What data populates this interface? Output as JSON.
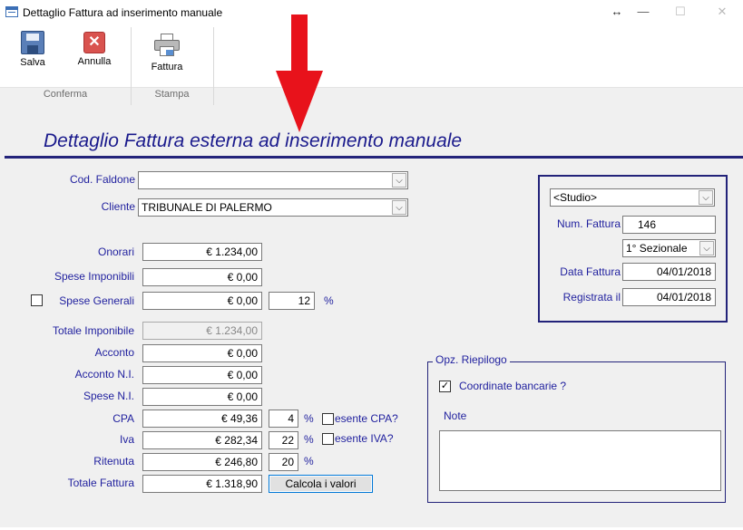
{
  "window": {
    "title": "Dettaglio Fattura ad inserimento manuale",
    "resize_glyph": "↔",
    "minimize_glyph": "—",
    "maximize_glyph": "☐",
    "close_glyph": "✕"
  },
  "ribbon": {
    "groups": [
      {
        "label": "Conferma"
      },
      {
        "label": "Stampa"
      }
    ],
    "buttons": {
      "save": {
        "label": "Salva",
        "icon": "floppy-disk-icon"
      },
      "cancel": {
        "label": "Annulla",
        "icon": "cancel-x-icon",
        "glyph": "✕"
      },
      "invoice": {
        "label": "Fattura",
        "icon": "printer-icon"
      }
    }
  },
  "heading": "Dettaglio Fattura esterna ad inserimento manuale",
  "form": {
    "cod_faldone": {
      "label": "Cod. Faldone",
      "value": ""
    },
    "cliente": {
      "label": "Cliente",
      "value": "TRIBUNALE DI PALERMO"
    },
    "onorari": {
      "label": "Onorari",
      "value": "€ 1.234,00"
    },
    "spese_imponibili": {
      "label": "Spese Imponibili",
      "value": "€ 0,00"
    },
    "spese_generali": {
      "label": "Spese Generali",
      "value": "€ 0,00",
      "percent": "12",
      "checked": false
    },
    "totale_imponibile": {
      "label": "Totale Imponibile",
      "value": "€ 1.234,00"
    },
    "acconto": {
      "label": "Acconto",
      "value": "€ 0,00"
    },
    "acconto_ni": {
      "label": "Acconto N.I.",
      "value": "€ 0,00"
    },
    "spese_ni": {
      "label": "Spese N.I.",
      "value": "€ 0,00"
    },
    "cpa": {
      "label": "CPA",
      "value": "€ 49,36",
      "percent": "4",
      "exempt_label": "esente CPA?",
      "exempt_checked": false
    },
    "iva": {
      "label": "Iva",
      "value": "€ 282,34",
      "percent": "22",
      "exempt_label": "esente IVA?",
      "exempt_checked": false
    },
    "ritenuta": {
      "label": "Ritenuta",
      "value": "€ 246,80",
      "percent": "20"
    },
    "totale_fattura": {
      "label": "Totale Fattura",
      "value": "€ 1.318,90"
    },
    "percent_sign": "%",
    "calc_button": "Calcola i valori"
  },
  "studio_panel": {
    "studio": "<Studio>",
    "num_fattura_label": "Num. Fattura",
    "num_fattura": "146",
    "sezionale": "1° Sezionale",
    "data_fattura_label": "Data Fattura",
    "data_fattura": "04/01/2018",
    "registrata_label": "Registrata il",
    "registrata": "04/01/2018"
  },
  "riepilogo": {
    "title": "Opz. Riepilogo",
    "coordinate_label": "Coordinate bancarie ?",
    "coordinate_checked": true,
    "note_label": "Note",
    "note_value": ""
  },
  "annotation": {
    "color": "#e8121b",
    "icon": "red-down-arrow"
  },
  "colors": {
    "label_blue": "#1f1f9e",
    "heading_navy": "#1a1a8c",
    "line_navy": "#23237a"
  }
}
